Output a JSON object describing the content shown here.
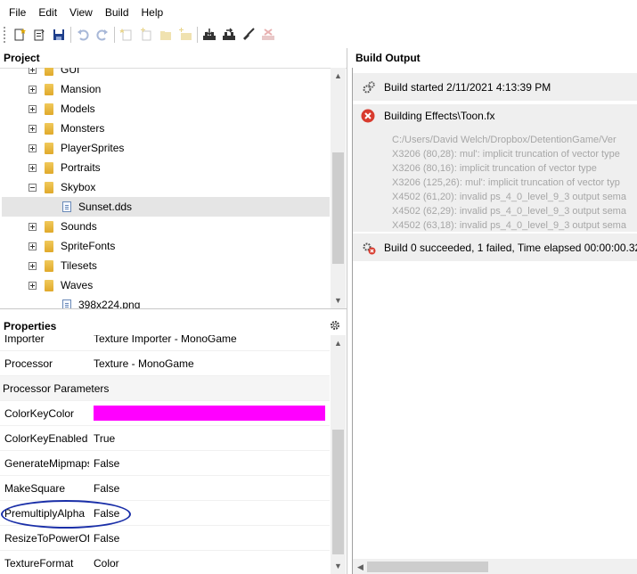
{
  "menu": [
    "File",
    "Edit",
    "View",
    "Build",
    "Help"
  ],
  "toolbar": {
    "buttons": [
      "new-icon",
      "open-icon",
      "save-icon",
      "undo-icon",
      "redo-icon",
      "new-item-icon",
      "add-item-icon",
      "new-folder-icon",
      "add-folder-icon",
      "build-icon",
      "rebuild-icon",
      "clean-icon",
      "cancel-build-icon"
    ]
  },
  "project": {
    "title": "Project",
    "items": [
      {
        "label": "GUI",
        "type": "folder"
      },
      {
        "label": "Mansion",
        "type": "folder"
      },
      {
        "label": "Models",
        "type": "folder"
      },
      {
        "label": "Monsters",
        "type": "folder"
      },
      {
        "label": "PlayerSprites",
        "type": "folder"
      },
      {
        "label": "Portraits",
        "type": "folder"
      },
      {
        "label": "Skybox",
        "type": "folder-open"
      },
      {
        "label": "Sunset.dds",
        "type": "file"
      },
      {
        "label": "Sounds",
        "type": "folder"
      },
      {
        "label": "SpriteFonts",
        "type": "folder"
      },
      {
        "label": "Tilesets",
        "type": "folder"
      },
      {
        "label": "Waves",
        "type": "folder"
      },
      {
        "label": "398x224.png",
        "type": "file"
      }
    ]
  },
  "properties": {
    "title": "Properties",
    "rows": [
      {
        "name": "Importer",
        "value": "Texture Importer - MonoGame"
      },
      {
        "name": "Processor",
        "value": "Texture - MonoGame"
      },
      {
        "category": "Processor Parameters"
      },
      {
        "name": "ColorKeyColor",
        "value": ""
      },
      {
        "name": "ColorKeyEnabled",
        "value": "True"
      },
      {
        "name": "GenerateMipmaps",
        "value": "False"
      },
      {
        "name": "MakeSquare",
        "value": "False"
      },
      {
        "name": "PremultiplyAlpha",
        "value": "False"
      },
      {
        "name": "ResizeToPowerOfTwo",
        "value": "False"
      },
      {
        "name": "TextureFormat",
        "value": "Color"
      }
    ],
    "colorkey_color": "#ff00ff"
  },
  "build_output": {
    "title": "Build Output",
    "started": "Build started 2/11/2021 4:13:39 PM",
    "building": "Building Effects\\Toon.fx",
    "details": [
      "C:/Users/David Welch/Dropbox/DetentionGame/Ver",
      "X3206 (80,28): mul': implicit truncation of vector type",
      "X3206 (80,16): implicit truncation of vector type",
      "X3206 (125,26): mul': implicit truncation of vector typ",
      "X4502 (61,20): invalid ps_4_0_level_9_3 output sema",
      "X4502 (62,29): invalid ps_4_0_level_9_3 output sema",
      "X4502 (63,18): invalid ps_4_0_level_9_3 output sema"
    ],
    "summary": "Build 0 succeeded, 1 failed, Time elapsed 00:00:00.32."
  }
}
